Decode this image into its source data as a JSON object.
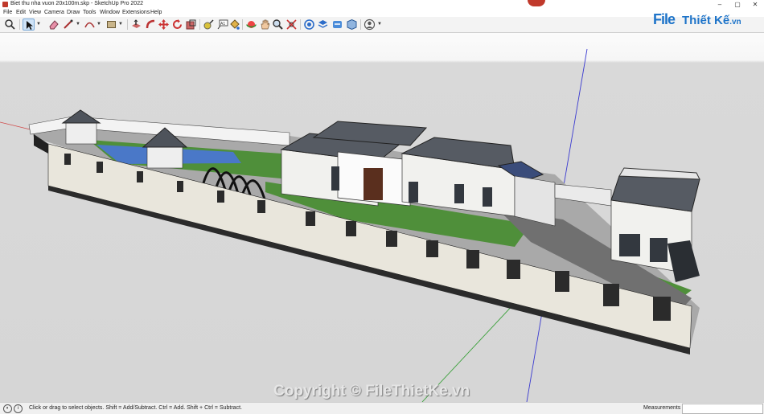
{
  "window": {
    "title": "Biet thu nha vuon 20x100m.skp - SketchUp Pro 2022",
    "controls": [
      "–",
      "▢",
      "✕"
    ]
  },
  "menu": [
    "File",
    "Edit",
    "View",
    "Camera",
    "Draw",
    "Tools",
    "Window",
    "Extensions",
    "Help"
  ],
  "brand": {
    "file": "File",
    "rest": "Thiết Kế",
    "suffix": ".vn"
  },
  "watermark": "Copyright © FileThietKe.vn",
  "status": {
    "message": "Click or drag to select objects. Shift = Add/Subtract. Ctrl = Add. Shift + Ctrl = Subtract.",
    "measurements_label": "Measurements",
    "measurements_value": ""
  },
  "colors": {
    "axis_red": "#d04a4a",
    "axis_green": "#3aa03a",
    "axis_blue": "#3a3ad0",
    "lawn": "#4f8f3a",
    "water": "#4a78c8",
    "roof": "#565b63",
    "wall": "#f1f1ee",
    "fence_dark": "#222222",
    "brand": "#1e74c9"
  }
}
